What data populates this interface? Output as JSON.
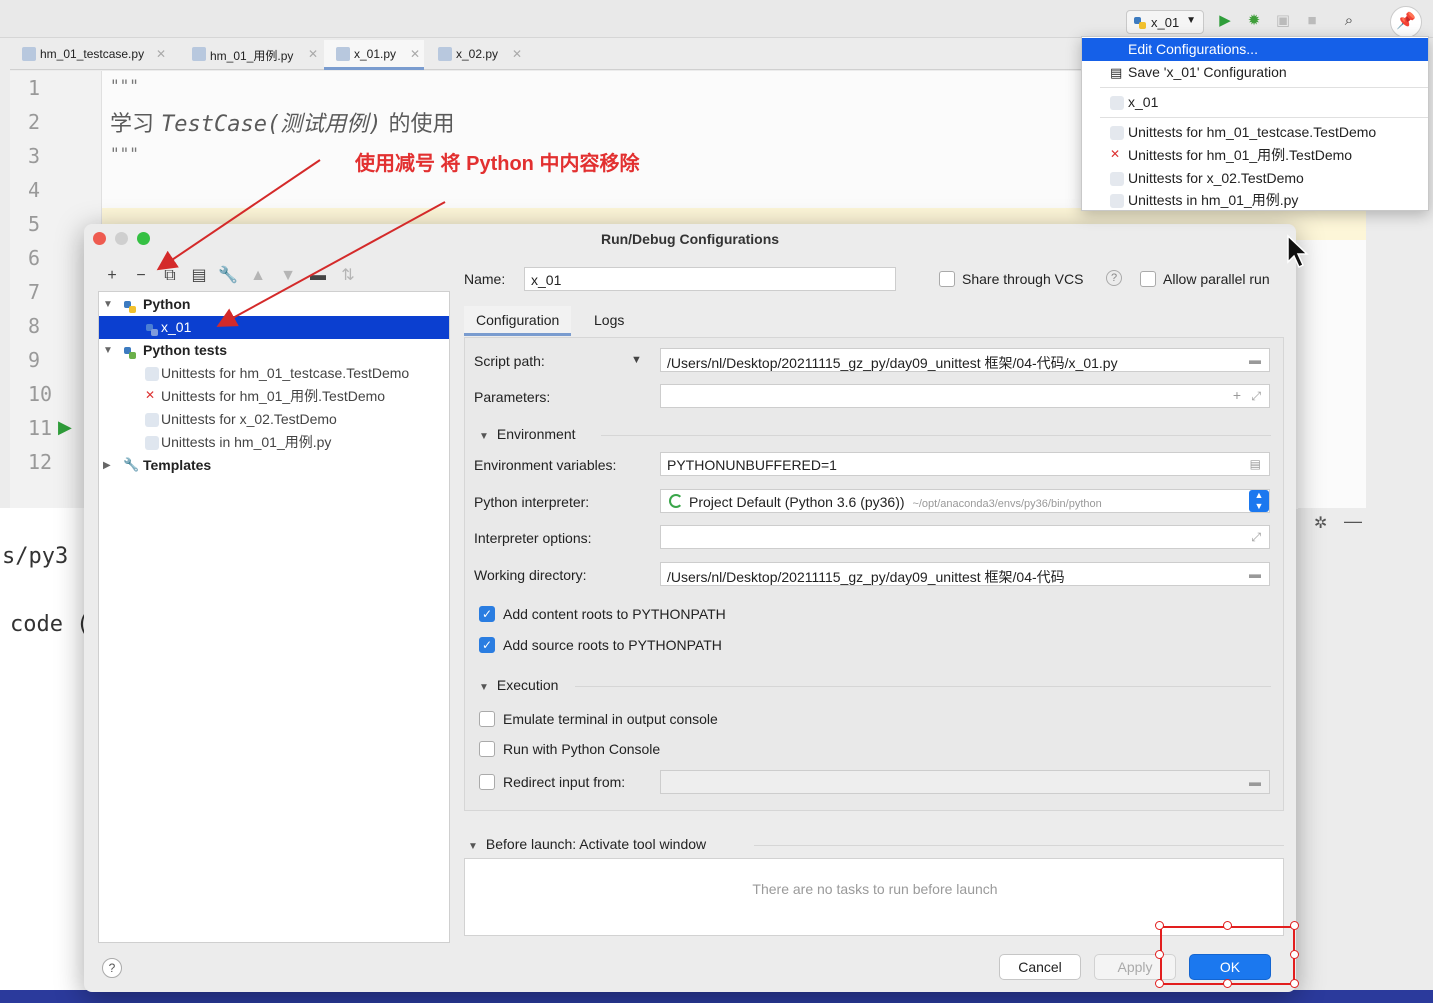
{
  "colors": {
    "accent": "#1b78ef",
    "selection": "#0b3fd0",
    "annotation": "#e23030"
  },
  "toolbar": {
    "run_config": "x_01"
  },
  "editor": {
    "tabs": [
      {
        "label": "hm_01_testcase.py"
      },
      {
        "label": "hm_01_用例.py"
      },
      {
        "label": "x_01.py"
      },
      {
        "label": "x_02.py"
      }
    ],
    "line_numbers": [
      "1",
      "2",
      "3",
      "4",
      "5",
      "6",
      "7",
      "8",
      "9",
      "10",
      "11",
      "12"
    ],
    "code": {
      "line1": "\"\"\"",
      "line2_prefix": "学习 ",
      "line2_class": "TestCase(测试用例)",
      "line2_suffix": " 的使用",
      "line3": "\"\"\""
    },
    "annotation": "使用减号 将 Python 中内容移除"
  },
  "terminal": {
    "line1": "s/py3",
    "line2": "code ("
  },
  "dialog": {
    "title": "Run/Debug Configurations",
    "tree": {
      "python": "Python",
      "x01": "x_01",
      "python_tests": "Python tests",
      "t1": "Unittests for hm_01_testcase.TestDemo",
      "t2": "Unittests for hm_01_用例.TestDemo",
      "t3": "Unittests for x_02.TestDemo",
      "t4": "Unittests in hm_01_用例.py",
      "templates": "Templates"
    },
    "name_label": "Name:",
    "name_value": "x_01",
    "share_vcs": "Share through VCS",
    "allow_parallel": "Allow parallel run",
    "tabs": {
      "configuration": "Configuration",
      "logs": "Logs"
    },
    "fields": {
      "script_path_label": "Script path:",
      "script_path": "/Users/nl/Desktop/20211115_gz_py/day09_unittest 框架/04-代码/x_01.py",
      "parameters_label": "Parameters:",
      "environment": "Environment",
      "env_vars_label": "Environment variables:",
      "env_vars": "PYTHONUNBUFFERED=1",
      "interpreter_label": "Python interpreter:",
      "interpreter": "Project Default (Python 3.6 (py36))",
      "interpreter_path": "~/opt/anaconda3/envs/py36/bin/python",
      "interp_options_label": "Interpreter options:",
      "working_dir_label": "Working directory:",
      "working_dir": "/Users/nl/Desktop/20211115_gz_py/day09_unittest 框架/04-代码",
      "content_roots": "Add content roots to PYTHONPATH",
      "source_roots": "Add source roots to PYTHONPATH",
      "execution": "Execution",
      "emulate_terminal": "Emulate terminal in output console",
      "python_console": "Run with Python Console",
      "redirect_input": "Redirect input from:"
    },
    "before_launch": "Before launch: Activate tool window",
    "no_tasks": "There are no tasks to run before launch",
    "buttons": {
      "cancel": "Cancel",
      "apply": "Apply",
      "ok": "OK",
      "help": "?"
    }
  },
  "dropdown": {
    "edit": "Edit Configurations...",
    "save": "Save 'x_01' Configuration",
    "x01": "x_01",
    "u1": "Unittests for hm_01_testcase.TestDemo",
    "u2": "Unittests for hm_01_用例.TestDemo",
    "u3": "Unittests for x_02.TestDemo",
    "u4": "Unittests in hm_01_用例.py"
  }
}
